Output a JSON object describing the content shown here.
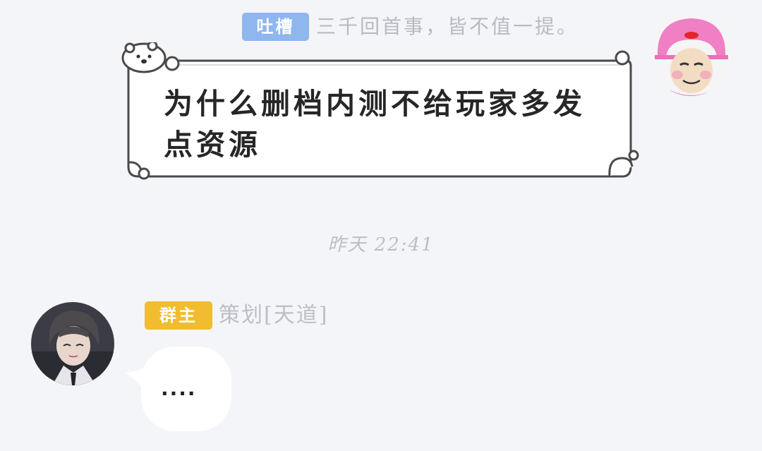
{
  "messages": [
    {
      "side": "right",
      "badge": "吐槽",
      "badge_color": "#8fb7ee",
      "sender_title": "三千回首事，皆不值一提。",
      "text": "为什么删档内测不给玩家多发点资源",
      "bubble_style": "polar-bear-frame"
    },
    {
      "side": "left",
      "badge": "群主",
      "badge_color": "#f1bc30",
      "sender_title": "策划[天道]",
      "text": "...."
    }
  ],
  "timestamp": "昨天  22:41",
  "colors": {
    "background": "#f4f5f9",
    "bubble_border": "#4a4a4a",
    "muted_text": "#bdbec3"
  },
  "icons": {
    "right_avatar": "meme-face-pink-helmet-avatar",
    "left_avatar": "anime-character-avatar",
    "bubble_decoration": "polar-bear-icon"
  }
}
